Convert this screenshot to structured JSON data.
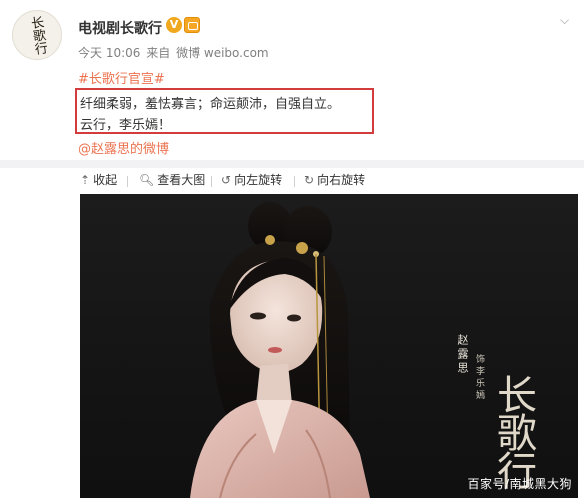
{
  "header": {
    "avatar_text": "长歌行",
    "account_name": "电视剧长歌行",
    "verified_icon": "V",
    "meta": {
      "time": "今天 10:06",
      "from_label": "来自",
      "source": "微博 weibo.com"
    }
  },
  "post": {
    "topic": "#长歌行官宣#",
    "line1": "纤细柔弱，羞怯寡言；命运颠沛，自强自立。",
    "line2": "云行，李乐嫣！",
    "mention": "@赵露思的微博",
    "highlight_color": "#d23c3c"
  },
  "toolbar": {
    "collapse": "收起",
    "view_large": "查看大图",
    "rotate_left": "向左旋转",
    "rotate_right": "向右旋转"
  },
  "image": {
    "credit_actor": "赵露思",
    "credit_role": "饰李乐嫣",
    "title_calligraphy": "长歌行",
    "watermark": "百家号/南城黑大狗"
  },
  "colors": {
    "link": "#eb7350",
    "verified": "#f0a81e"
  }
}
